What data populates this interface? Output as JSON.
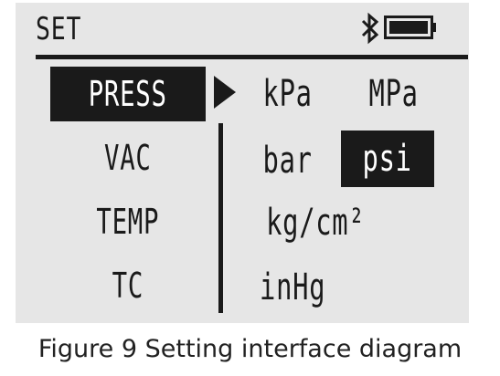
{
  "header": {
    "title": "SET",
    "bluetooth_icon": "bluetooth-icon",
    "battery_icon": "battery-icon",
    "battery_level": 1.0
  },
  "menu": {
    "items": [
      {
        "label": "PRESS",
        "selected": true
      },
      {
        "label": "VAC",
        "selected": false
      },
      {
        "label": "TEMP",
        "selected": false
      },
      {
        "label": "TC",
        "selected": false
      }
    ],
    "pointer_icon": "triangle-right-icon"
  },
  "units": {
    "items": [
      {
        "label": "kPa",
        "selected": false
      },
      {
        "label": "MPa",
        "selected": false
      },
      {
        "label": "bar",
        "selected": false
      },
      {
        "label": "psi",
        "selected": true
      },
      {
        "label": "kg/cm²",
        "selected": false
      },
      {
        "label": "inHg",
        "selected": false
      }
    ]
  },
  "caption": "Figure 9 Setting interface diagram",
  "colors": {
    "screen_bg": "#e6e6e6",
    "ink": "#1a1a1a",
    "highlight_text": "#ffffff"
  }
}
